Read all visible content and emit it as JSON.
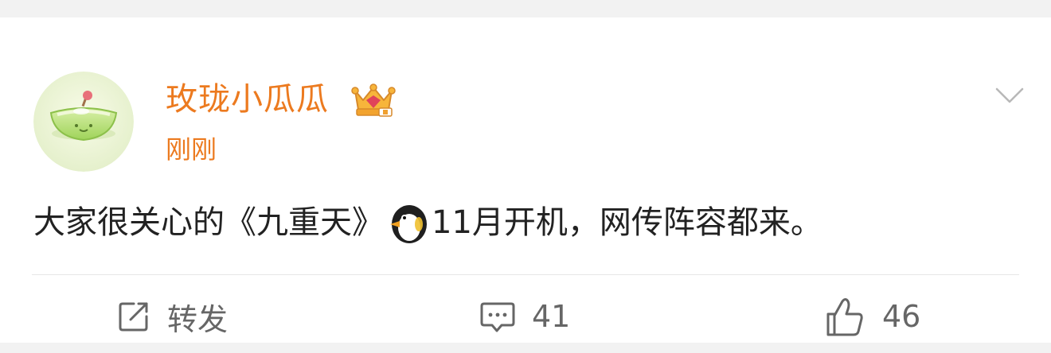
{
  "user": {
    "name": "玫珑小瓜瓜",
    "time": "刚刚",
    "avatar": "melon-avatar",
    "badge_icon": "crown-badge-icon"
  },
  "post": {
    "text_before_emoji": "大家很关心的《九重天》",
    "emoji": "penguin-emoji",
    "text_after_emoji": "11月开机，网传阵容都来。"
  },
  "actions": {
    "repost_label": "转发",
    "comment_count": "41",
    "like_count": "46"
  },
  "colors": {
    "accent": "#ec7a1f",
    "text": "#222222",
    "muted": "#666666",
    "background": "#f2f2f2"
  }
}
